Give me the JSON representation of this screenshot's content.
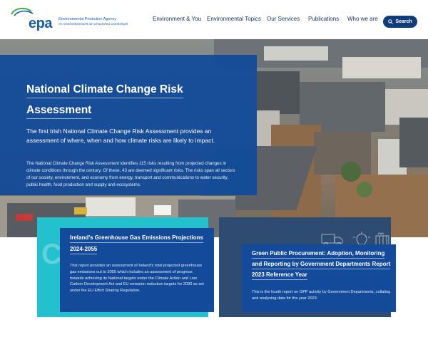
{
  "header": {
    "logo_text": "epa",
    "logo_sub1": "Environmental Protection Agency",
    "logo_sub2": "An Ghníomhaireacht um Chaomhnú Comhshaoil",
    "nav": [
      {
        "label": "Environment & You"
      },
      {
        "label": "Environmental Topics"
      },
      {
        "label": "Our Services"
      },
      {
        "label": "Publications"
      },
      {
        "label": "Who we are"
      }
    ],
    "search_label": "Search"
  },
  "hero": {
    "title": "National Climate Change Risk Assessment",
    "lead": "The first Irish National Climate Change Risk Assessment provides an assessment of where, when and how climate risks are likely to impact.",
    "body": "The National Climate Change Risk Assessment identifies 115 risks resulting from projected changes in climate conditions through the century. Of these, 43 are deemed significant risks. The risks span all sectors of our society, environment, and economy from energy, transport and communications to water security, public health, food production and supply and ecosystems."
  },
  "cards": [
    {
      "title": "Ireland's Greenhouse Gas Emissions Projections 2024-2055",
      "body": "This report provides an assessment of Ireland's total projected greenhouse gas emissions out to 2055 which includes an assessment of progress towards achieving its National targets under the Climate Action and Low Carbon Development Act and EU emission reduction targets for 2030 as set under the EU Effort Sharing Regulation."
    },
    {
      "title": "Green Public Procurement: Adoption, Monitoring and Reporting by Government Departments Report 2023 Reference Year",
      "body": "This is the fourth report on GPP activity by Government Departments, collating and analysing data for the year 2023."
    }
  ],
  "colors": {
    "brand_blue": "#144a9a",
    "navy": "#103c7a",
    "teal": "#22c1cd",
    "slate": "#2e4c72"
  }
}
